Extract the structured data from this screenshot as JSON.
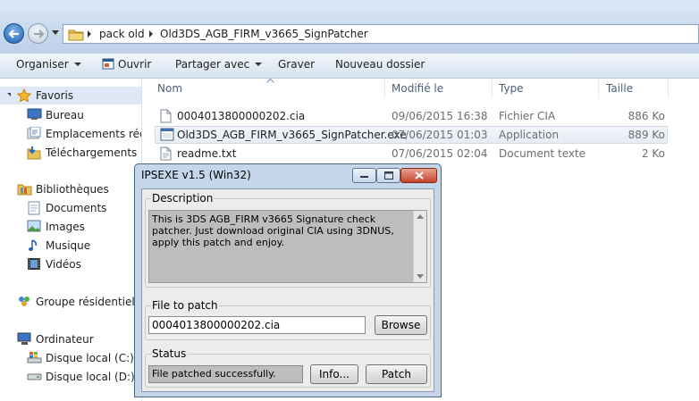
{
  "explorer": {
    "breadcrumb": [
      "pack old",
      "Old3DS_AGB_FIRM_v3665_SignPatcher"
    ],
    "toolbar": {
      "organize": "Organiser",
      "open": "Ouvrir",
      "share": "Partager avec",
      "burn": "Graver",
      "new_folder": "Nouveau dossier"
    },
    "nav": {
      "favorites": "Favoris",
      "desktop": "Bureau",
      "recent": "Emplacements récents",
      "downloads": "Téléchargements",
      "libraries": "Bibliothèques",
      "documents": "Documents",
      "images": "Images",
      "music": "Musique",
      "videos": "Vidéos",
      "homegroup": "Groupe résidentiel",
      "computer": "Ordinateur",
      "drive_c": "Disque local (C:)",
      "drive_d": "Disque local (D:)"
    },
    "columns": {
      "name": "Nom",
      "modified": "Modifié le",
      "type": "Type",
      "size": "Taille"
    },
    "files": [
      {
        "name": "0004013800000202.cia",
        "modified": "09/06/2015 16:38",
        "type": "Fichier CIA",
        "size": "886 Ko"
      },
      {
        "name": "Old3DS_AGB_FIRM_v3665_SignPatcher.exe",
        "modified": "07/06/2015 01:03",
        "type": "Application",
        "size": "889 Ko"
      },
      {
        "name": "readme.txt",
        "modified": "07/06/2015 02:04",
        "type": "Document texte",
        "size": "2 Ko"
      }
    ]
  },
  "dialog": {
    "title": "IPSEXE v1.5 (Win32)",
    "description_label": "Description",
    "description_text": "This is 3DS AGB_FIRM v3665 Signature check patcher. Just download original CIA using 3DNUS, apply this patch and enjoy.",
    "file_label": "File to patch",
    "file_value": "0004013800000202.cia",
    "browse": "Browse",
    "status_label": "Status",
    "status_text": "File patched successfully.",
    "info": "Info...",
    "patch": "Patch"
  }
}
